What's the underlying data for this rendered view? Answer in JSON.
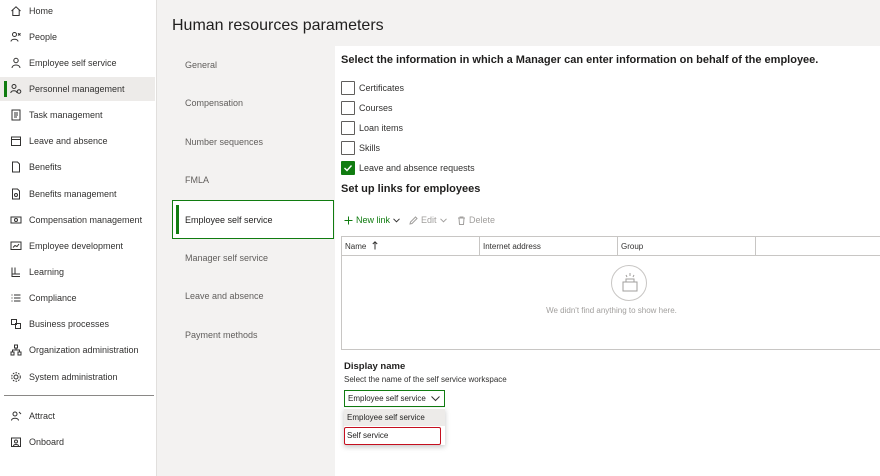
{
  "nav": {
    "items": [
      {
        "label": "Home",
        "icon": "home-icon"
      },
      {
        "label": "People",
        "icon": "people-icon"
      },
      {
        "label": "Employee self service",
        "icon": "person-icon"
      },
      {
        "label": "Personnel management",
        "icon": "people-settings-icon",
        "selected": true
      },
      {
        "label": "Task management",
        "icon": "task-list-icon"
      },
      {
        "label": "Leave and absence",
        "icon": "calendar-icon"
      },
      {
        "label": "Benefits",
        "icon": "document-icon"
      },
      {
        "label": "Benefits management",
        "icon": "document-settings-icon"
      },
      {
        "label": "Compensation management",
        "icon": "money-icon"
      },
      {
        "label": "Employee development",
        "icon": "development-icon"
      },
      {
        "label": "Learning",
        "icon": "learning-icon"
      },
      {
        "label": "Compliance",
        "icon": "list-icon"
      },
      {
        "label": "Business processes",
        "icon": "flow-icon"
      },
      {
        "label": "Organization administration",
        "icon": "org-chart-icon"
      },
      {
        "label": "System administration",
        "icon": "gear-icon"
      }
    ],
    "lower_items": [
      {
        "label": "Attract",
        "icon": "attract-icon"
      },
      {
        "label": "Onboard",
        "icon": "onboard-icon"
      }
    ]
  },
  "page": {
    "title": "Human resources parameters"
  },
  "tabs": [
    {
      "label": "General"
    },
    {
      "label": "Compensation"
    },
    {
      "label": "Number sequences"
    },
    {
      "label": "FMLA"
    },
    {
      "label": "Employee self service",
      "selected": true
    },
    {
      "label": "Manager self service"
    },
    {
      "label": "Leave and absence"
    },
    {
      "label": "Payment methods"
    }
  ],
  "manager_section": {
    "heading": "Select the information in which a Manager can enter information on behalf of the employee.",
    "options": [
      {
        "label": "Certificates",
        "checked": false
      },
      {
        "label": "Courses",
        "checked": false
      },
      {
        "label": "Loan items",
        "checked": false
      },
      {
        "label": "Skills",
        "checked": false
      },
      {
        "label": "Leave and absence requests",
        "checked": true
      }
    ]
  },
  "links_section": {
    "heading": "Set up links for employees",
    "toolbar": {
      "new_link": "New link",
      "edit": "Edit",
      "delete": "Delete"
    },
    "grid": {
      "columns": [
        "Name",
        "Internet address",
        "Group"
      ],
      "sort_column": "Name",
      "empty_text": "We didn't find anything to show here."
    }
  },
  "display_name": {
    "label": "Display name",
    "help": "Select the name of the self service workspace",
    "selected_value": "Employee self service",
    "options": [
      "Employee self service",
      "Self service"
    ],
    "highlighted_option": "Self service"
  },
  "colors": {
    "accent": "#107c10",
    "highlight": "#c50f1f"
  }
}
